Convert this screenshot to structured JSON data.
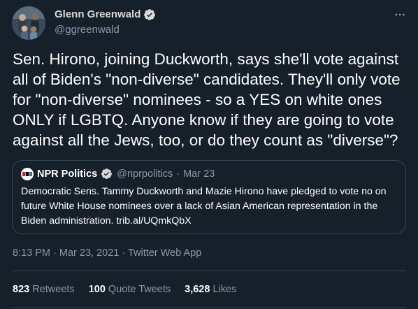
{
  "author": {
    "name": "Glenn Greenwald",
    "handle": "@ggreenwald"
  },
  "tweet": {
    "text": "Sen. Hirono, joining Duckworth, says she'll vote against all of Biden's \"non-diverse\" candidates. They'll only vote for \"non-diverse\" nominees - so a YES on white ones ONLY if LGBTQ. Anyone know if they are going to vote against all the Jews, too, or do they count as \"diverse\"?"
  },
  "quote": {
    "name": "NPR Politics",
    "handle": "@nprpolitics",
    "separator": "·",
    "date": "Mar 23",
    "text": "Democratic Sens. Tammy Duckworth and Mazie Hirono have pledged to vote no on future White House nominees over a lack of Asian American representation in the Biden administration. trib.al/UQmkQbX"
  },
  "meta": {
    "time": "8:13 PM",
    "sep1": "·",
    "date": "Mar 23, 2021",
    "sep2": "·",
    "source": "Twitter Web App"
  },
  "stats": {
    "retweets_count": "823",
    "retweets_label": "Retweets",
    "quotes_count": "100",
    "quotes_label": "Quote Tweets",
    "likes_count": "3,628",
    "likes_label": "Likes"
  },
  "icons": {
    "more": "more-horizontal-icon",
    "verified": "verified-badge-icon"
  },
  "colors": {
    "background": "#15202b",
    "verified": "#d9d9d9",
    "secondary_text": "#8b98a5",
    "border": "#38444d"
  }
}
